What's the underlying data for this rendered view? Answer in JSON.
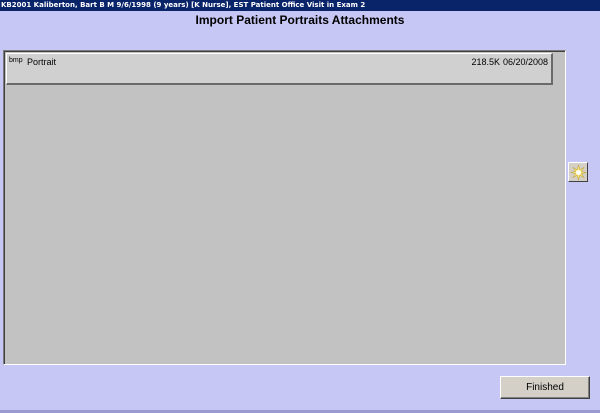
{
  "window": {
    "title": "KB2001 Kaliberton, Bart B  M  9/6/1998 (9 years)  [K Nurse], EST Patient Office Visit in Exam 2"
  },
  "page": {
    "heading": "Import Patient Portraits Attachments"
  },
  "attachments": [
    {
      "type": "bmp",
      "name": "Portrait",
      "size": "218.5K",
      "date": "06/20/2008"
    }
  ],
  "actions": {
    "new_icon": "starburst-icon",
    "finished_label": "Finished"
  },
  "colors": {
    "background": "#c7c7f5",
    "title_bar": "#0a246a",
    "panel": "#c2c2c2"
  }
}
